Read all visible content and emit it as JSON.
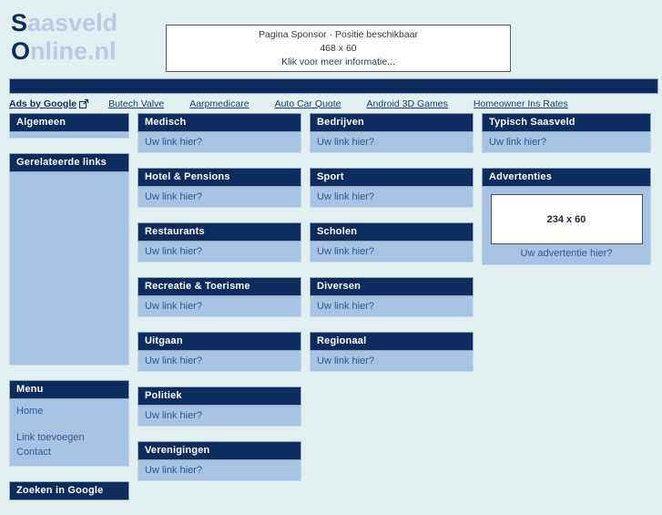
{
  "site": {
    "logo_line1_cap": "S",
    "logo_line1_rest": "aasveld",
    "logo_line2_cap": "O",
    "logo_line2_rest": "nline.nl"
  },
  "sponsor": {
    "line1": "Pagina Sponsor · Positie beschikbaar",
    "line2": "468 x 60",
    "line3": "Klik voor meer informatie..."
  },
  "adsbar": {
    "label": "Ads by Google",
    "icon": "external-link-icon",
    "links": [
      "Butech Valve",
      "Aarpmedicare",
      "Auto Car Quote",
      "Android 3D Games",
      "Homeowner Ins Rates"
    ]
  },
  "sidebar": {
    "algemeen": {
      "title": "Algemeen"
    },
    "gerelateerde": {
      "title": "Gerelateerde links"
    },
    "menu": {
      "title": "Menu",
      "items": [
        "Home",
        "Link toevoegen",
        "Contact"
      ]
    },
    "zoeken": {
      "title": "Zoeken in Google"
    }
  },
  "link_placeholder": "Uw link hier?",
  "columns": {
    "one": [
      "Medisch",
      "Hotel & Pensions",
      "Restaurants",
      "Recreatie & Toerisme",
      "Uitgaan",
      "Politiek",
      "Verenigingen"
    ],
    "two": [
      "Bedrijven",
      "Sport",
      "Scholen",
      "Diversen",
      "Regionaal"
    ],
    "three_title": "Typisch Saasveld"
  },
  "advertenties": {
    "title": "Advertenties",
    "slot_size": "234 x 60",
    "caption": "Uw advertentie hier?"
  },
  "colors": {
    "background": "#e2eff0",
    "navy": "#0d2c5e",
    "panel_body": "#a7c3e3",
    "link": "#2f5c92",
    "logo_light": "#b6cbe6"
  }
}
